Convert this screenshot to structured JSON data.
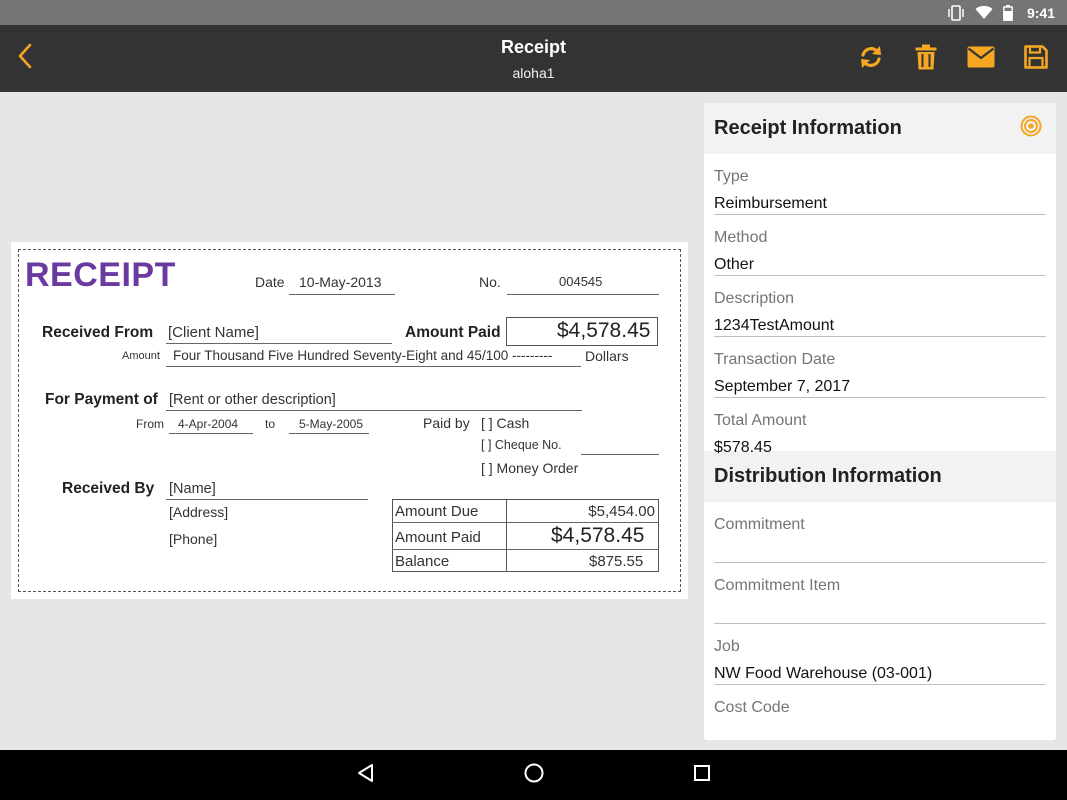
{
  "status_bar": {
    "time": "9:41"
  },
  "app_bar": {
    "title": "Receipt",
    "subtitle": "aloha1"
  },
  "receipt_image": {
    "title": "RECEIPT",
    "date_label": "Date",
    "date_value": "10-May-2013",
    "no_label": "No.",
    "no_value": "004545",
    "received_from_label": "Received From",
    "received_from_value": "[Client Name]",
    "amount_paid_label": "Amount Paid",
    "amount_paid_value": "$4,578.45",
    "amount_label": "Amount",
    "amount_words": "Four Thousand Five Hundred Seventy-Eight and 45/100 ---------",
    "dollars_label": "Dollars",
    "for_payment_label": "For Payment of",
    "for_payment_value": "[Rent or other description]",
    "from_label": "From",
    "from_value": "4-Apr-2004",
    "to_label": "to",
    "to_value": "5-May-2005",
    "paid_by_label": "Paid by",
    "option_cash": "[ ]  Cash",
    "option_cheque": "[ ]  Cheque No.",
    "option_money_order": "[ ]  Money Order",
    "received_by_label": "Received By",
    "received_by_value": "[Name]",
    "address_value": "[Address]",
    "phone_value": "[Phone]",
    "summary": [
      {
        "label": "Amount Due",
        "value": "$5,454.00"
      },
      {
        "label": "Amount Paid",
        "value": "$4,578.45"
      },
      {
        "label": "Balance",
        "value": "$875.55"
      }
    ]
  },
  "receipt_info": {
    "title": "Receipt Information",
    "fields": [
      {
        "label": "Type",
        "value": "Reimbursement"
      },
      {
        "label": "Method",
        "value": "Other"
      },
      {
        "label": "Description",
        "value": "1234TestAmount"
      },
      {
        "label": "Transaction Date",
        "value": "September 7, 2017"
      },
      {
        "label": "Total Amount",
        "value": "$578.45"
      }
    ]
  },
  "distribution_info": {
    "title": "Distribution Information",
    "fields": [
      {
        "label": "Commitment",
        "value": ""
      },
      {
        "label": "Commitment Item",
        "value": ""
      },
      {
        "label": "Job",
        "value": "NW Food Warehouse (03-001)"
      },
      {
        "label": "Cost Code",
        "value": ""
      }
    ]
  },
  "colors": {
    "accent": "#f5a623",
    "app_bar": "#333333",
    "receipt_title": "#6b3aa0"
  },
  "icons": {
    "back": "chevron-left-icon",
    "refresh": "refresh-icon",
    "delete": "trash-icon",
    "email": "envelope-icon",
    "save": "save-icon",
    "target": "target-icon"
  }
}
